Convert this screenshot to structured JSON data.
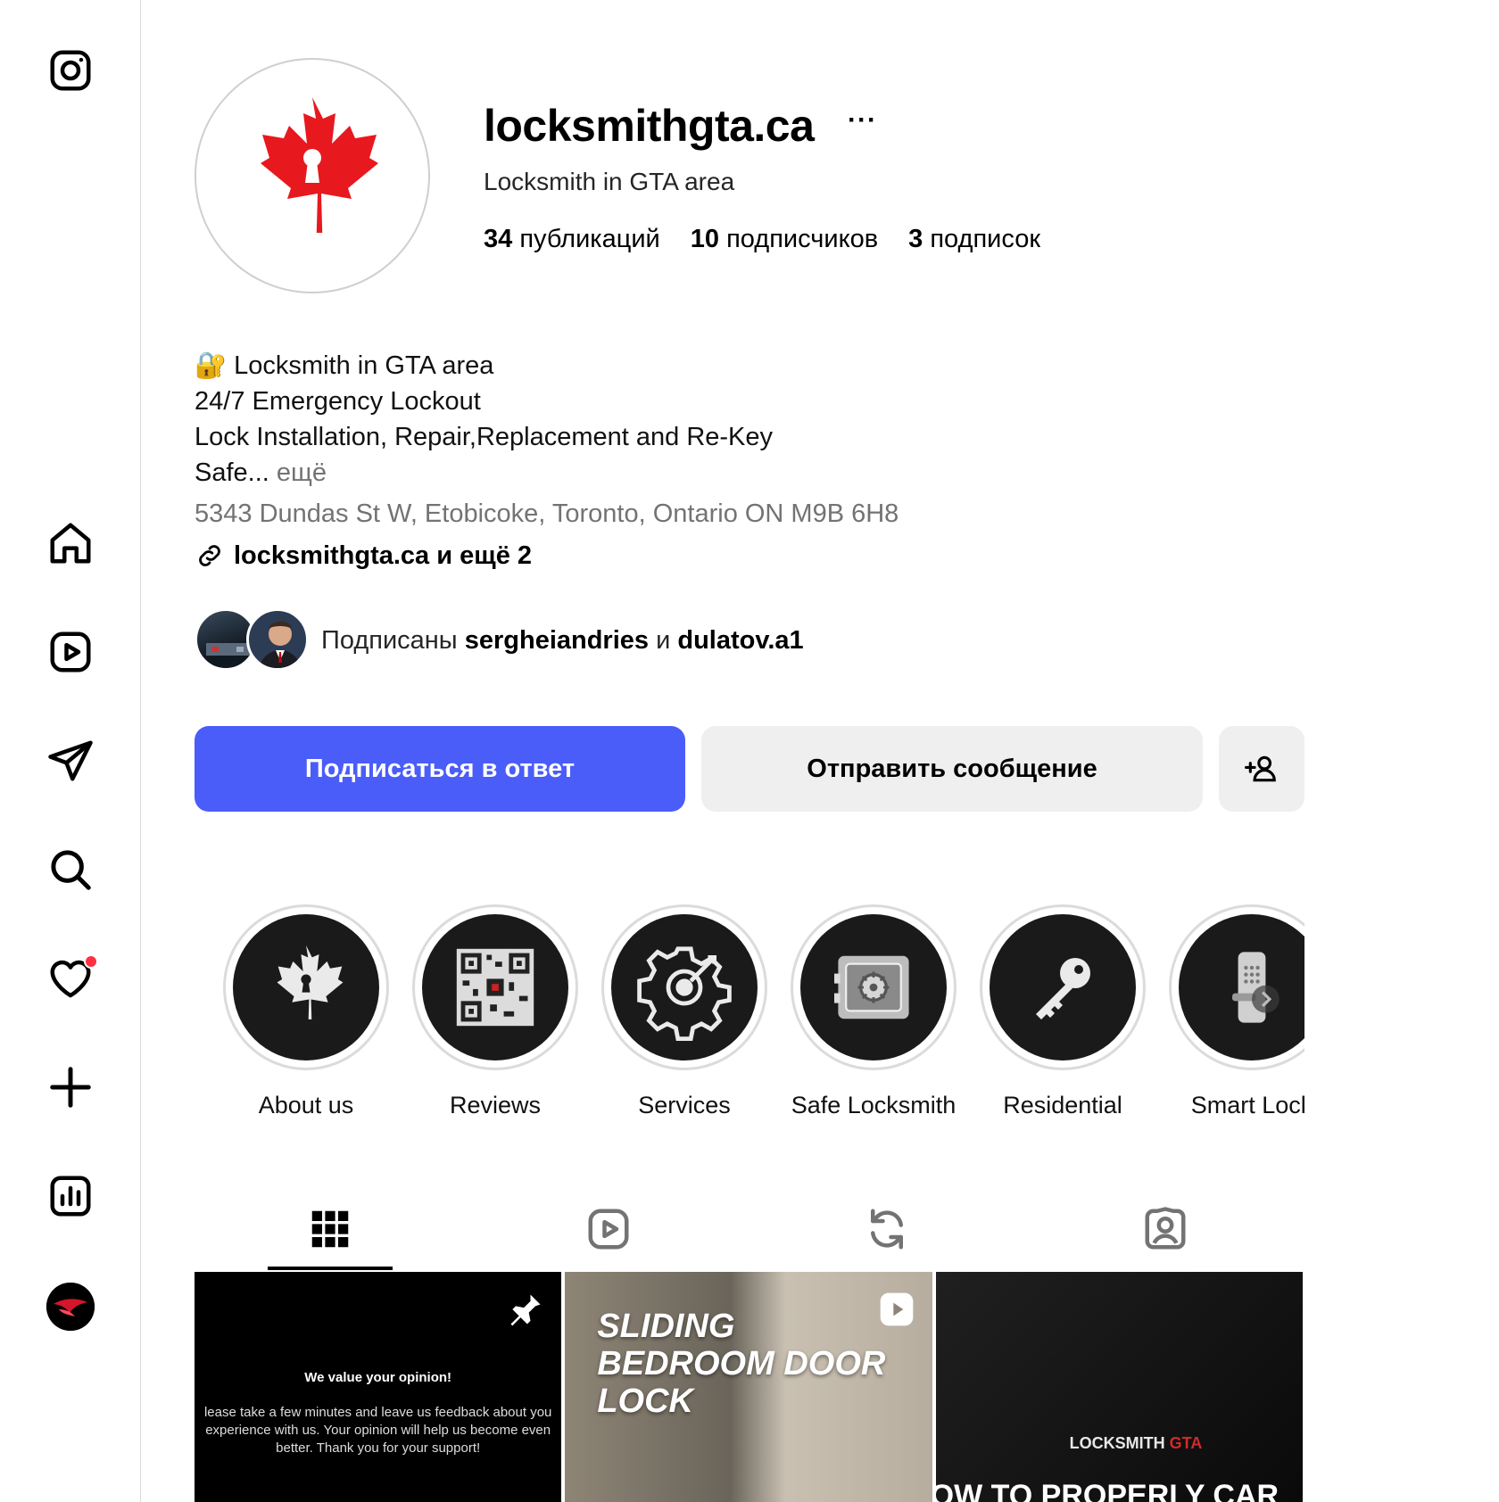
{
  "profile": {
    "username": "locksmithgta.ca",
    "more_label": "···",
    "subtitle": "Locksmith in GTA area",
    "stats": {
      "posts_count": "34",
      "posts_label": "публикаций",
      "followers_count": "10",
      "followers_label": "подписчиков",
      "following_count": "3",
      "following_label": "подписок"
    }
  },
  "bio": {
    "line1": "Locksmith in GTA area",
    "line1_emoji": "🔐",
    "line2": "24/7 Emergency Lockout",
    "line3": "Lock Installation, Repair,Replacement and Re-Key",
    "line4": "Safe...",
    "more": "ещё",
    "address": "5343 Dundas St W, Etobicoke, Toronto, Ontario ON M9B 6H8",
    "link": "locksmithgta.ca и ещё 2"
  },
  "followed_by": {
    "prefix": "Подписаны",
    "user1": "sergheiandries",
    "conjunction": "и",
    "user2": "dulatov.a1"
  },
  "actions": {
    "follow_back": "Подписаться в ответ",
    "send_message": "Отправить сообщение",
    "add_user_icon": "person-plus-icon"
  },
  "highlights": [
    {
      "label": "About us",
      "icon": "maple-leaf-lock-icon"
    },
    {
      "label": "Reviews",
      "icon": "qr-code-icon"
    },
    {
      "label": "Services",
      "icon": "gear-icon"
    },
    {
      "label": "Safe Locksmith",
      "icon": "safe-icon"
    },
    {
      "label": "Residential",
      "icon": "key-icon"
    },
    {
      "label": "Smart Lock",
      "icon": "smart-lock-icon"
    }
  ],
  "tabs": [
    {
      "name": "posts",
      "icon": "grid-icon"
    },
    {
      "name": "reels",
      "icon": "reels-icon"
    },
    {
      "name": "reposts",
      "icon": "repost-icon"
    },
    {
      "name": "tagged",
      "icon": "tagged-icon"
    }
  ],
  "posts": [
    {
      "title": "We value your opinion!",
      "body": "lease take a few minutes and leave us feedback about you experience with us. Your opinion will help us become even better. Thank you for your support!",
      "badge": "pin-icon"
    },
    {
      "heading_1": "SLIDING",
      "heading_2": "BEDROOM DOOR",
      "heading_3": "LOCK",
      "badge": "reel-icon"
    },
    {
      "logo_a": "LOCKSMITH ",
      "logo_b": "GTA",
      "heading": "OW TO PROPERLY CAR"
    }
  ],
  "colors": {
    "accent": "#4a5df9",
    "maple_red": "#e8181f",
    "notification": "#ff3040"
  }
}
